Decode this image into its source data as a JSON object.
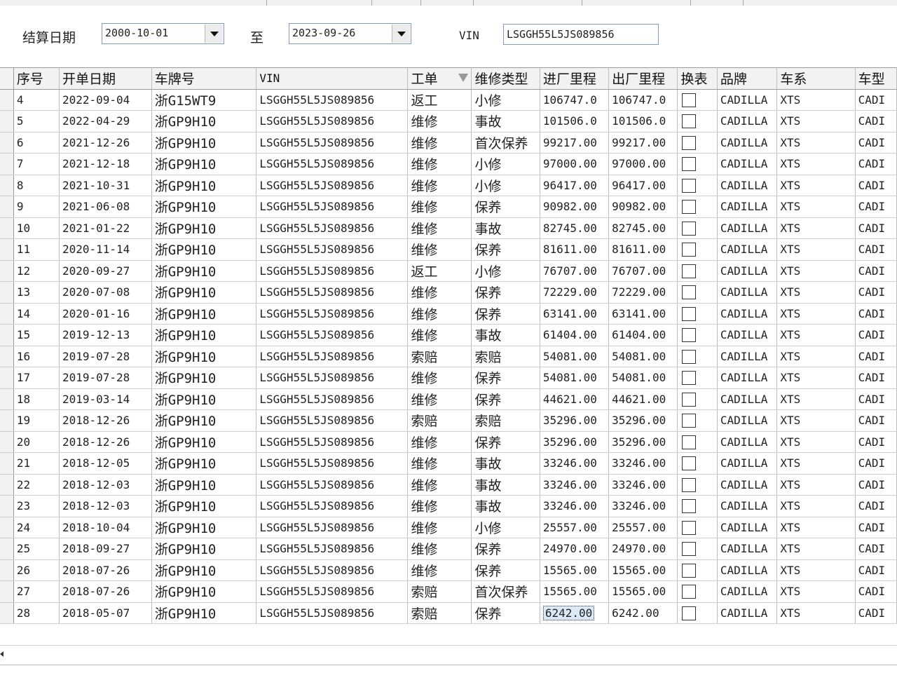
{
  "filter": {
    "settle_date_label": "结算日期",
    "from_date": "2000-10-01",
    "to_label": "至",
    "to_date": "2023-09-26",
    "vin_label": "VIN",
    "vin_value": "LSGGH55L5JS089856"
  },
  "table": {
    "columns": [
      "序号",
      "开单日期",
      "车牌号",
      "VIN",
      "工单",
      "维修类型",
      "进厂里程",
      "出厂里程",
      "换表",
      "品牌",
      "车系",
      "车型"
    ],
    "rows": [
      {
        "no": "4",
        "date": "2022-09-04",
        "plate": "浙G15WT9",
        "vin": "LSGGH55L5JS089856",
        "order": "返工",
        "type": "小修",
        "in": "106747.0",
        "out": "106747.0",
        "brand": "CADILLA",
        "series": "XTS",
        "model": "CADI"
      },
      {
        "no": "5",
        "date": "2022-04-29",
        "plate": "浙GP9H10",
        "vin": "LSGGH55L5JS089856",
        "order": "维修",
        "type": "事故",
        "in": "101506.0",
        "out": "101506.0",
        "brand": "CADILLA",
        "series": "XTS",
        "model": "CADI"
      },
      {
        "no": "6",
        "date": "2021-12-26",
        "plate": "浙GP9H10",
        "vin": "LSGGH55L5JS089856",
        "order": "维修",
        "type": "首次保养",
        "in": "99217.00",
        "out": "99217.00",
        "brand": "CADILLA",
        "series": "XTS",
        "model": "CADI"
      },
      {
        "no": "7",
        "date": "2021-12-18",
        "plate": "浙GP9H10",
        "vin": "LSGGH55L5JS089856",
        "order": "维修",
        "type": "小修",
        "in": "97000.00",
        "out": "97000.00",
        "brand": "CADILLA",
        "series": "XTS",
        "model": "CADI"
      },
      {
        "no": "8",
        "date": "2021-10-31",
        "plate": "浙GP9H10",
        "vin": "LSGGH55L5JS089856",
        "order": "维修",
        "type": "小修",
        "in": "96417.00",
        "out": "96417.00",
        "brand": "CADILLA",
        "series": "XTS",
        "model": "CADI"
      },
      {
        "no": "9",
        "date": "2021-06-08",
        "plate": "浙GP9H10",
        "vin": "LSGGH55L5JS089856",
        "order": "维修",
        "type": "保养",
        "in": "90982.00",
        "out": "90982.00",
        "brand": "CADILLA",
        "series": "XTS",
        "model": "CADI"
      },
      {
        "no": "10",
        "date": "2021-01-22",
        "plate": "浙GP9H10",
        "vin": "LSGGH55L5JS089856",
        "order": "维修",
        "type": "事故",
        "in": "82745.00",
        "out": "82745.00",
        "brand": "CADILLA",
        "series": "XTS",
        "model": "CADI"
      },
      {
        "no": "11",
        "date": "2020-11-14",
        "plate": "浙GP9H10",
        "vin": "LSGGH55L5JS089856",
        "order": "维修",
        "type": "保养",
        "in": "81611.00",
        "out": "81611.00",
        "brand": "CADILLA",
        "series": "XTS",
        "model": "CADI"
      },
      {
        "no": "12",
        "date": "2020-09-27",
        "plate": "浙GP9H10",
        "vin": "LSGGH55L5JS089856",
        "order": "返工",
        "type": "小修",
        "in": "76707.00",
        "out": "76707.00",
        "brand": "CADILLA",
        "series": "XTS",
        "model": "CADI"
      },
      {
        "no": "13",
        "date": "2020-07-08",
        "plate": "浙GP9H10",
        "vin": "LSGGH55L5JS089856",
        "order": "维修",
        "type": "保养",
        "in": "72229.00",
        "out": "72229.00",
        "brand": "CADILLA",
        "series": "XTS",
        "model": "CADI"
      },
      {
        "no": "14",
        "date": "2020-01-16",
        "plate": "浙GP9H10",
        "vin": "LSGGH55L5JS089856",
        "order": "维修",
        "type": "保养",
        "in": "63141.00",
        "out": "63141.00",
        "brand": "CADILLA",
        "series": "XTS",
        "model": "CADI"
      },
      {
        "no": "15",
        "date": "2019-12-13",
        "plate": "浙GP9H10",
        "vin": "LSGGH55L5JS089856",
        "order": "维修",
        "type": "事故",
        "in": "61404.00",
        "out": "61404.00",
        "brand": "CADILLA",
        "series": "XTS",
        "model": "CADI"
      },
      {
        "no": "16",
        "date": "2019-07-28",
        "plate": "浙GP9H10",
        "vin": "LSGGH55L5JS089856",
        "order": "索赔",
        "type": "索赔",
        "in": "54081.00",
        "out": "54081.00",
        "brand": "CADILLA",
        "series": "XTS",
        "model": "CADI"
      },
      {
        "no": "17",
        "date": "2019-07-28",
        "plate": "浙GP9H10",
        "vin": "LSGGH55L5JS089856",
        "order": "维修",
        "type": "保养",
        "in": "54081.00",
        "out": "54081.00",
        "brand": "CADILLA",
        "series": "XTS",
        "model": "CADI"
      },
      {
        "no": "18",
        "date": "2019-03-14",
        "plate": "浙GP9H10",
        "vin": "LSGGH55L5JS089856",
        "order": "维修",
        "type": "保养",
        "in": "44621.00",
        "out": "44621.00",
        "brand": "CADILLA",
        "series": "XTS",
        "model": "CADI"
      },
      {
        "no": "19",
        "date": "2018-12-26",
        "plate": "浙GP9H10",
        "vin": "LSGGH55L5JS089856",
        "order": "索赔",
        "type": "索赔",
        "in": "35296.00",
        "out": "35296.00",
        "brand": "CADILLA",
        "series": "XTS",
        "model": "CADI"
      },
      {
        "no": "20",
        "date": "2018-12-26",
        "plate": "浙GP9H10",
        "vin": "LSGGH55L5JS089856",
        "order": "维修",
        "type": "保养",
        "in": "35296.00",
        "out": "35296.00",
        "brand": "CADILLA",
        "series": "XTS",
        "model": "CADI"
      },
      {
        "no": "21",
        "date": "2018-12-05",
        "plate": "浙GP9H10",
        "vin": "LSGGH55L5JS089856",
        "order": "维修",
        "type": "事故",
        "in": "33246.00",
        "out": "33246.00",
        "brand": "CADILLA",
        "series": "XTS",
        "model": "CADI"
      },
      {
        "no": "22",
        "date": "2018-12-03",
        "plate": "浙GP9H10",
        "vin": "LSGGH55L5JS089856",
        "order": "维修",
        "type": "事故",
        "in": "33246.00",
        "out": "33246.00",
        "brand": "CADILLA",
        "series": "XTS",
        "model": "CADI"
      },
      {
        "no": "23",
        "date": "2018-12-03",
        "plate": "浙GP9H10",
        "vin": "LSGGH55L5JS089856",
        "order": "维修",
        "type": "事故",
        "in": "33246.00",
        "out": "33246.00",
        "brand": "CADILLA",
        "series": "XTS",
        "model": "CADI"
      },
      {
        "no": "24",
        "date": "2018-10-04",
        "plate": "浙GP9H10",
        "vin": "LSGGH55L5JS089856",
        "order": "维修",
        "type": "小修",
        "in": "25557.00",
        "out": "25557.00",
        "brand": "CADILLA",
        "series": "XTS",
        "model": "CADI"
      },
      {
        "no": "25",
        "date": "2018-09-27",
        "plate": "浙GP9H10",
        "vin": "LSGGH55L5JS089856",
        "order": "维修",
        "type": "保养",
        "in": "24970.00",
        "out": "24970.00",
        "brand": "CADILLA",
        "series": "XTS",
        "model": "CADI"
      },
      {
        "no": "26",
        "date": "2018-07-26",
        "plate": "浙GP9H10",
        "vin": "LSGGH55L5JS089856",
        "order": "维修",
        "type": "保养",
        "in": "15565.00",
        "out": "15565.00",
        "brand": "CADILLA",
        "series": "XTS",
        "model": "CADI"
      },
      {
        "no": "27",
        "date": "2018-07-26",
        "plate": "浙GP9H10",
        "vin": "LSGGH55L5JS089856",
        "order": "索赔",
        "type": "首次保养",
        "in": "15565.00",
        "out": "15565.00",
        "brand": "CADILLA",
        "series": "XTS",
        "model": "CADI"
      },
      {
        "no": "28",
        "date": "2018-05-07",
        "plate": "浙GP9H10",
        "vin": "LSGGH55L5JS089856",
        "order": "索赔",
        "type": "保养",
        "in": "6242.00",
        "out": "6242.00",
        "brand": "CADILLA",
        "series": "XTS",
        "model": "CADI"
      }
    ]
  }
}
